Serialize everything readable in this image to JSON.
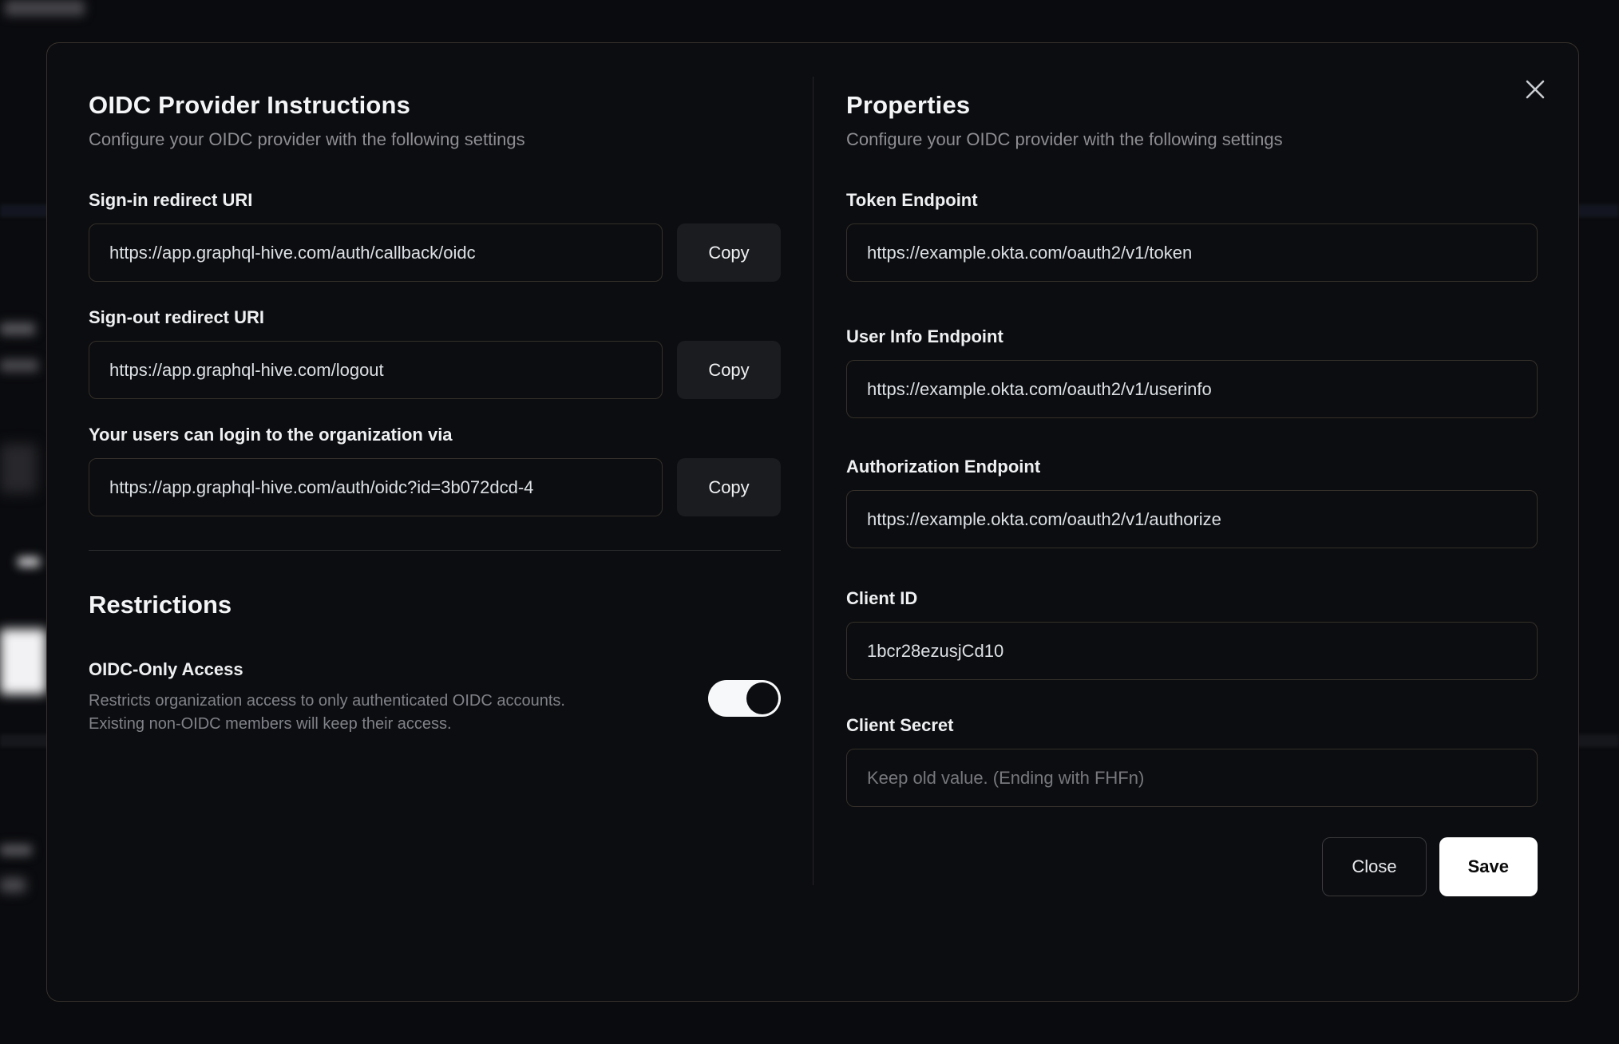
{
  "modal": {
    "left": {
      "title": "OIDC Provider Instructions",
      "subtitle": "Configure your OIDC provider with the following settings",
      "fields": [
        {
          "label": "Sign-in redirect URI",
          "value": "https://app.graphql-hive.com/auth/callback/oidc",
          "button": "Copy"
        },
        {
          "label": "Sign-out redirect URI",
          "value": "https://app.graphql-hive.com/logout",
          "button": "Copy"
        },
        {
          "label": "Your users can login to the organization via",
          "value": "https://app.graphql-hive.com/auth/oidc?id=3b072dcd-4",
          "button": "Copy"
        }
      ],
      "restrictions": {
        "title": "Restrictions",
        "toggle_label": "OIDC-Only Access",
        "description_line1": "Restricts organization access to only authenticated OIDC accounts.",
        "description_line2": "Existing non-OIDC members will keep their access.",
        "toggle_state": "on"
      }
    },
    "right": {
      "title": "Properties",
      "subtitle": "Configure your OIDC provider with the following settings",
      "fields": [
        {
          "label": "Token Endpoint",
          "value": "https://example.okta.com/oauth2/v1/token"
        },
        {
          "label": "User Info Endpoint",
          "value": "https://example.okta.com/oauth2/v1/userinfo"
        },
        {
          "label": "Authorization Endpoint",
          "value": "https://example.okta.com/oauth2/v1/authorize"
        },
        {
          "label": "Client ID",
          "value": "1bcr28ezusjCd10"
        },
        {
          "label": "Client Secret",
          "value": "",
          "placeholder": "Keep old value. (Ending with FHFn)"
        }
      ],
      "buttons": {
        "close": "Close",
        "save": "Save"
      }
    },
    "colors": {
      "modal_background": "#0c0d10",
      "page_background": "#0a0b0e",
      "accent_button": "#ffffff",
      "toggle_on": "#f7f8f9"
    }
  }
}
